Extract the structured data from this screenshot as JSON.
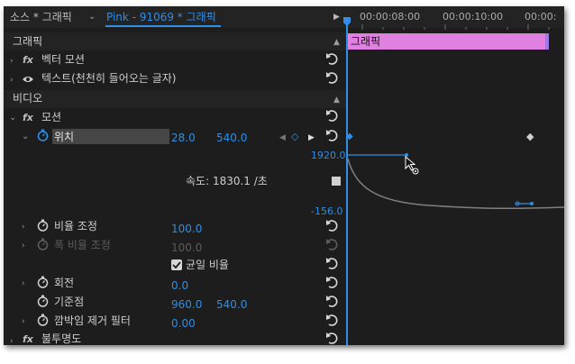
{
  "tabs": {
    "source": "소스 * 그래픽",
    "sequence": "Pink - 91069 * 그래픽"
  },
  "timeline": {
    "ticks": [
      "00:00:08:00",
      "00:00:10:00",
      "00:00:"
    ],
    "clip_label": "그래픽"
  },
  "sections": {
    "graphic": "그래픽",
    "video": "비디오"
  },
  "effects": {
    "vector_motion": "벡터 모션",
    "text_layer": "텍스트(천천히 들어오는 글자)",
    "motion": "모션",
    "opacity": "불투명도"
  },
  "properties": {
    "position": {
      "label": "위치",
      "x": "28.0",
      "y": "540.0"
    },
    "scale": {
      "label": "비율 조정",
      "value": "100.0"
    },
    "scale_width": {
      "label": "폭 비율 조정",
      "value": "100.0"
    },
    "uniform_scale": {
      "label": "균일 비율",
      "checked": true
    },
    "rotation": {
      "label": "회전",
      "value": "0.0"
    },
    "anchor": {
      "label": "기준점",
      "x": "960.0",
      "y": "540.0"
    },
    "flicker": {
      "label": "깜박임 제거 필터",
      "value": "0.00"
    }
  },
  "graph": {
    "velocity_label": "속도: 1830.1 /초",
    "top_value": "1920.0",
    "bottom_value": "-156.0"
  },
  "colors": {
    "accent_blue": "#2f8ee6",
    "clip_pink": "#e080e0",
    "clip_handle": "#9a7ae8",
    "panel_bg": "#1d1d1d"
  }
}
